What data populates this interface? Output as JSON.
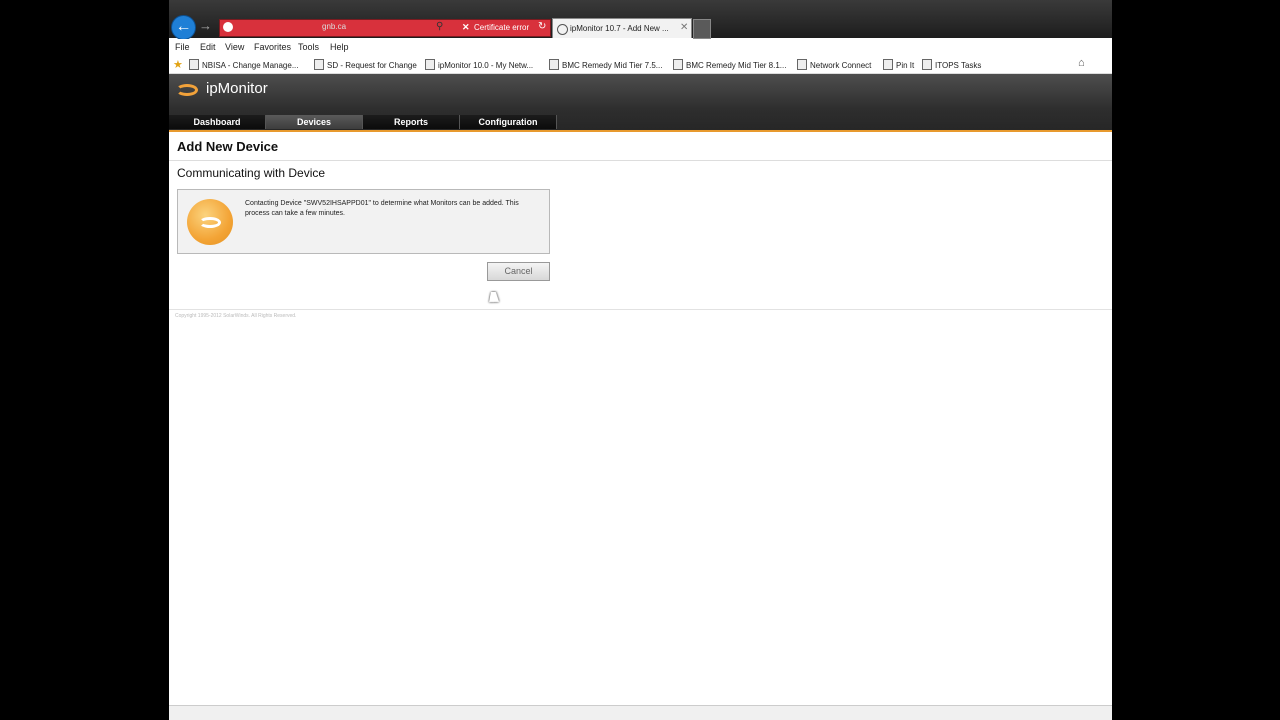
{
  "browser": {
    "address_url": "gnb.ca",
    "certificate_error": "Certificate error",
    "tab_title": "ipMonitor 10.7 - Add New ...",
    "menu": [
      "File",
      "Edit",
      "View",
      "Favorites",
      "Tools",
      "Help"
    ],
    "favorites": [
      "NBISA - Change Manage...",
      "SD - Request for Change",
      "ipMonitor 10.0 - My Netw...",
      "BMC Remedy Mid Tier 7.5...",
      "BMC Remedy Mid Tier 8.1...",
      "Network Connect",
      "Pin It",
      "ITOPS Tasks"
    ]
  },
  "app": {
    "brand": "ipMonitor",
    "nav": [
      "Dashboard",
      "Devices",
      "Reports",
      "Configuration"
    ],
    "active_nav": "Devices",
    "accent_color": "#e89a2e"
  },
  "page": {
    "title": "Add New Device",
    "section_title": "Communicating with Device",
    "message": "Contacting Device \"SWV52IHSAPPD01\" to determine what Monitors can be added. This process can take a few minutes.",
    "cancel_label": "Cancel",
    "copyright": "Copyright 1995-2012 SolarWinds. All Rights Reserved."
  }
}
